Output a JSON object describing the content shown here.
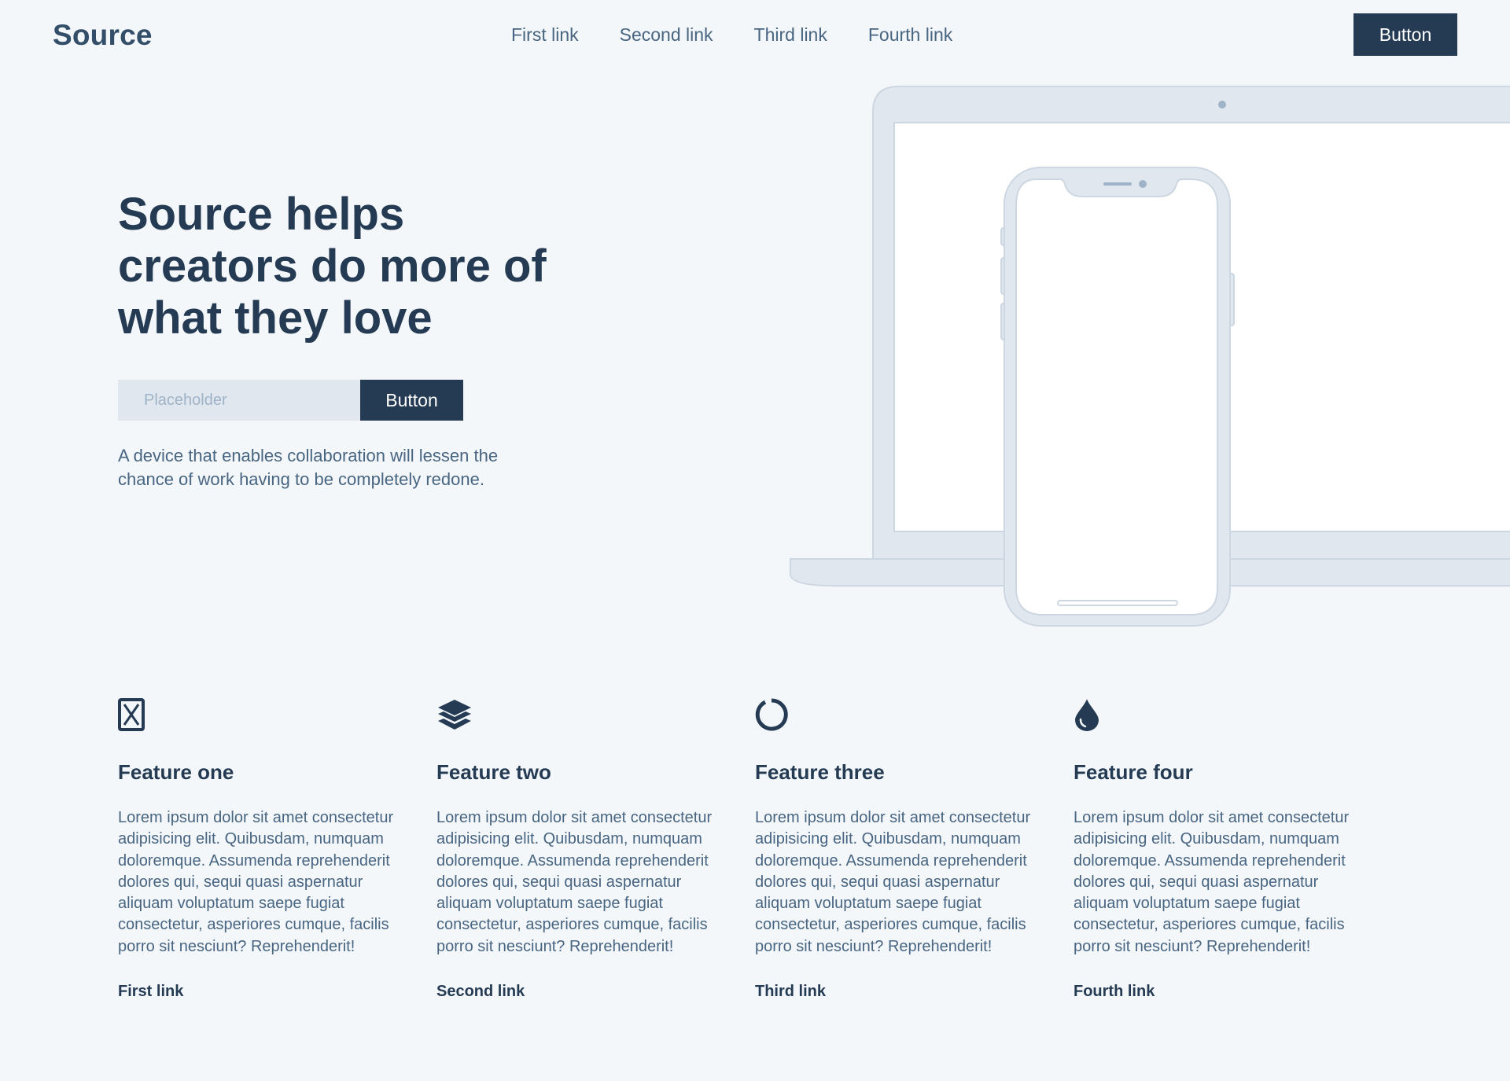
{
  "header": {
    "logo": "Source",
    "nav": [
      "First link",
      "Second link",
      "Third link",
      "Fourth link"
    ],
    "button_label": "Button"
  },
  "hero": {
    "title": "Source helps creators do more of what they love",
    "input_placeholder": "Placeholder",
    "button_label": "Button",
    "description": "A device that enables collaboration will lessen the chance of work having to be completely redone."
  },
  "features": [
    {
      "icon": "hourglass-icon",
      "title": "Feature one",
      "text": "Lorem ipsum dolor sit amet consectetur adipisicing elit. Quibusdam, numquam doloremque. Assumenda reprehenderit dolores qui, sequi quasi aspernatur aliquam voluptatum saepe fugiat consectetur, asperiores cumque, facilis porro sit nesciunt? Reprehenderit!",
      "link": "First link"
    },
    {
      "icon": "layers-icon",
      "title": "Feature two",
      "text": "Lorem ipsum dolor sit amet consectetur adipisicing elit. Quibusdam, numquam doloremque. Assumenda reprehenderit dolores qui, sequi quasi aspernatur aliquam voluptatum saepe fugiat consectetur, asperiores cumque, facilis porro sit nesciunt? Reprehenderit!",
      "link": "Second link"
    },
    {
      "icon": "loading-circle-icon",
      "title": "Feature three",
      "text": "Lorem ipsum dolor sit amet consectetur adipisicing elit. Quibusdam, numquam doloremque. Assumenda reprehenderit dolores qui, sequi quasi aspernatur aliquam voluptatum saepe fugiat consectetur, asperiores cumque, facilis porro sit nesciunt? Reprehenderit!",
      "link": "Third link"
    },
    {
      "icon": "water-drop-icon",
      "title": "Feature four",
      "text": "Lorem ipsum dolor sit amet consectetur adipisicing elit. Quibusdam, numquam doloremque. Assumenda reprehenderit dolores qui, sequi quasi aspernatur aliquam voluptatum saepe fugiat consectetur, asperiores cumque, facilis porro sit nesciunt? Reprehenderit!",
      "link": "Fourth link"
    }
  ],
  "colors": {
    "background": "#f4f7fa",
    "primary": "#243b53",
    "text_muted": "#486581",
    "device_frame": "#e1e7ee",
    "device_stroke": "#cdd7e1"
  }
}
